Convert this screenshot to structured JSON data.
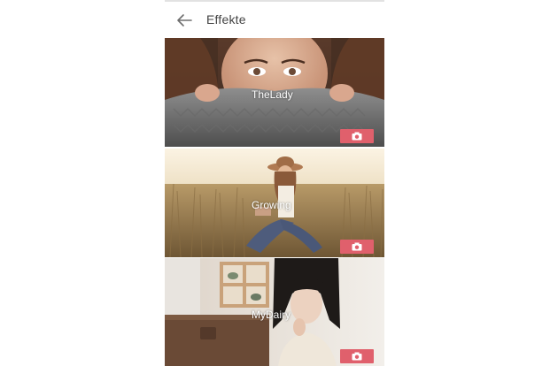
{
  "header": {
    "title": "Effekte"
  },
  "effects": [
    {
      "label": "TheLady"
    },
    {
      "label": "Growing"
    },
    {
      "label": "MyDairy"
    }
  ],
  "colors": {
    "accent": "#e0606c",
    "header_text": "#444444",
    "label_text": "#ffffff"
  },
  "icons": {
    "back": "arrow-back-icon",
    "camera": "camera-icon"
  }
}
